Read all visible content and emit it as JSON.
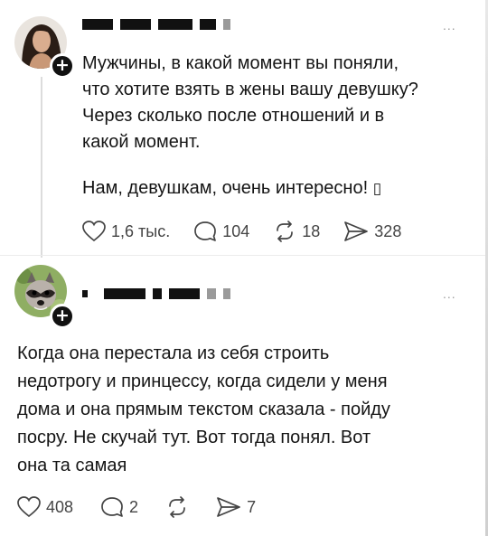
{
  "post": {
    "text_para1": "Мужчины, в какой момент вы поняли,\nчто хотите взять в жены вашу девушку?\nЧерез сколько после отношений и в\nкакой момент.",
    "text_para2": "Нам, девушкам, очень интересно! ",
    "emoji_box": "▯",
    "likes": "1,6 тыс.",
    "comments": "104",
    "reposts": "18",
    "shares": "328",
    "more": "..."
  },
  "reply": {
    "text": "Когда она перестала из себя строить\nнедотрогу и принцессу, когда сидели у меня\nдома и она прямым текстом сказала - пойду\nпосру. Не скучай тут. Вот тогда понял. Вот\nона та самая",
    "likes": "408",
    "comments": "2",
    "shares": "7",
    "more": "..."
  },
  "icons": {
    "follow": "plus-icon",
    "like": "heart-icon",
    "comment": "speech-bubble-icon",
    "repost": "repost-arrows-icon",
    "share": "send-icon"
  },
  "colors": {
    "text": "#151515",
    "muted": "#444444",
    "divider": "#ececec",
    "badge": "#111111"
  }
}
